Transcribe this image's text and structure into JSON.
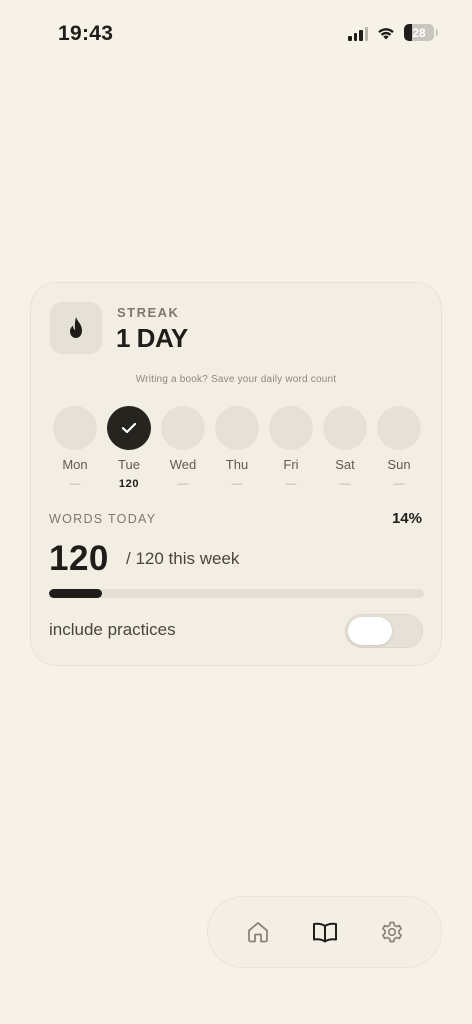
{
  "status_bar": {
    "time": "19:43",
    "battery": "28",
    "icons": [
      "cellular-signal-icon",
      "wifi-icon",
      "battery-icon"
    ]
  },
  "streak": {
    "icon": "flame-icon",
    "label": "STREAK",
    "value": "1 DAY",
    "hint": "Writing a book? Save your daily word count"
  },
  "week": [
    {
      "name": "Mon",
      "count": "—",
      "done": false
    },
    {
      "name": "Tue",
      "count": "120",
      "done": true
    },
    {
      "name": "Wed",
      "count": "—",
      "done": false
    },
    {
      "name": "Thu",
      "count": "—",
      "done": false
    },
    {
      "name": "Fri",
      "count": "—",
      "done": false
    },
    {
      "name": "Sat",
      "count": "—",
      "done": false
    },
    {
      "name": "Sun",
      "count": "—",
      "done": false
    }
  ],
  "words_today": {
    "label": "WORDS TODAY",
    "percent": "14%",
    "progress": 0.14,
    "count": "120",
    "week_total": "/ 120 this week"
  },
  "practices": {
    "label": "include practices",
    "enabled": false
  },
  "tabbar": {
    "items": [
      {
        "icon": "home-icon",
        "active": false
      },
      {
        "icon": "book-icon",
        "active": true
      },
      {
        "icon": "gear-icon",
        "active": false
      }
    ]
  },
  "colors": {
    "background": "#f6f2e8",
    "card": "#f3eee4",
    "accent": "#1f1d1a",
    "muted": "#e6e1d7"
  }
}
